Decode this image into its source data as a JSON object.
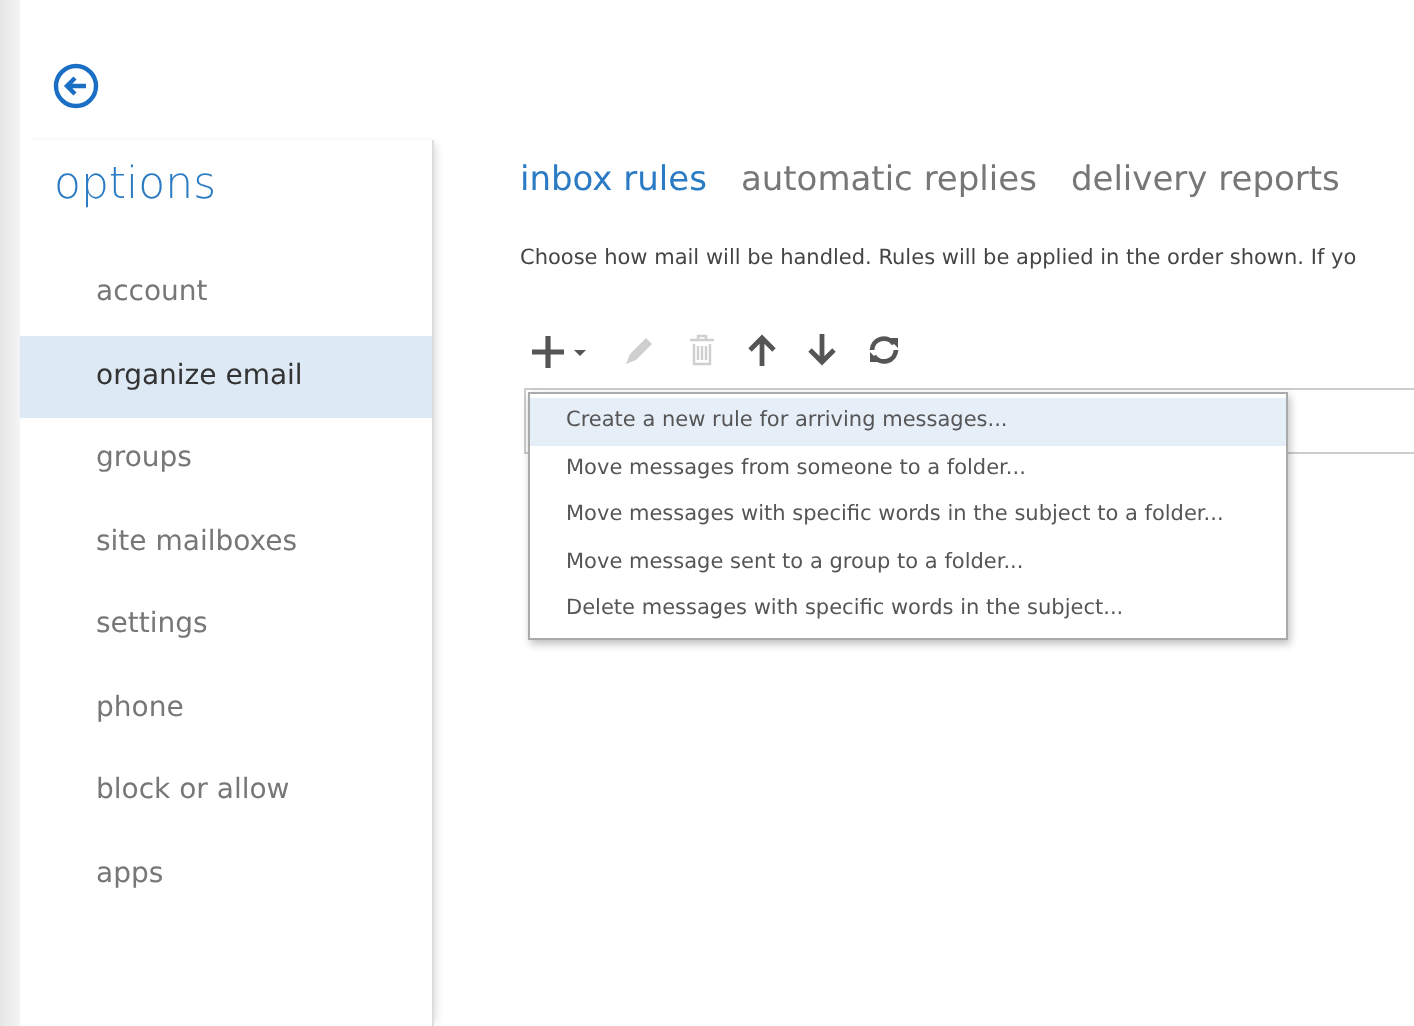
{
  "sidebar": {
    "title": "options",
    "items": [
      {
        "label": "account",
        "selected": false
      },
      {
        "label": "organize email",
        "selected": true
      },
      {
        "label": "groups",
        "selected": false
      },
      {
        "label": "site mailboxes",
        "selected": false
      },
      {
        "label": "settings",
        "selected": false
      },
      {
        "label": "phone",
        "selected": false
      },
      {
        "label": "block or allow",
        "selected": false
      },
      {
        "label": "apps",
        "selected": false
      }
    ]
  },
  "tabs": [
    {
      "label": "inbox rules",
      "selected": true
    },
    {
      "label": "automatic replies",
      "selected": false
    },
    {
      "label": "delivery reports",
      "selected": false
    }
  ],
  "description": "Choose how mail will be handled. Rules will be applied in the order shown. If yo",
  "toolbar": [
    {
      "kind": "add",
      "disabled": false
    },
    {
      "kind": "edit",
      "disabled": true
    },
    {
      "kind": "delete",
      "disabled": true
    },
    {
      "kind": "up",
      "disabled": false
    },
    {
      "kind": "down",
      "disabled": false
    },
    {
      "kind": "refresh",
      "disabled": false
    }
  ],
  "menu": [
    {
      "label": "Create a new rule for arriving messages...",
      "selected": true
    },
    {
      "label": "Move messages from someone to a folder...",
      "selected": false
    },
    {
      "label": "Move messages with specific words in the subject to a folder...",
      "selected": false
    },
    {
      "label": "Move message sent to a group to a folder...",
      "selected": false
    },
    {
      "label": "Delete messages with specific words in the subject...",
      "selected": false
    }
  ]
}
